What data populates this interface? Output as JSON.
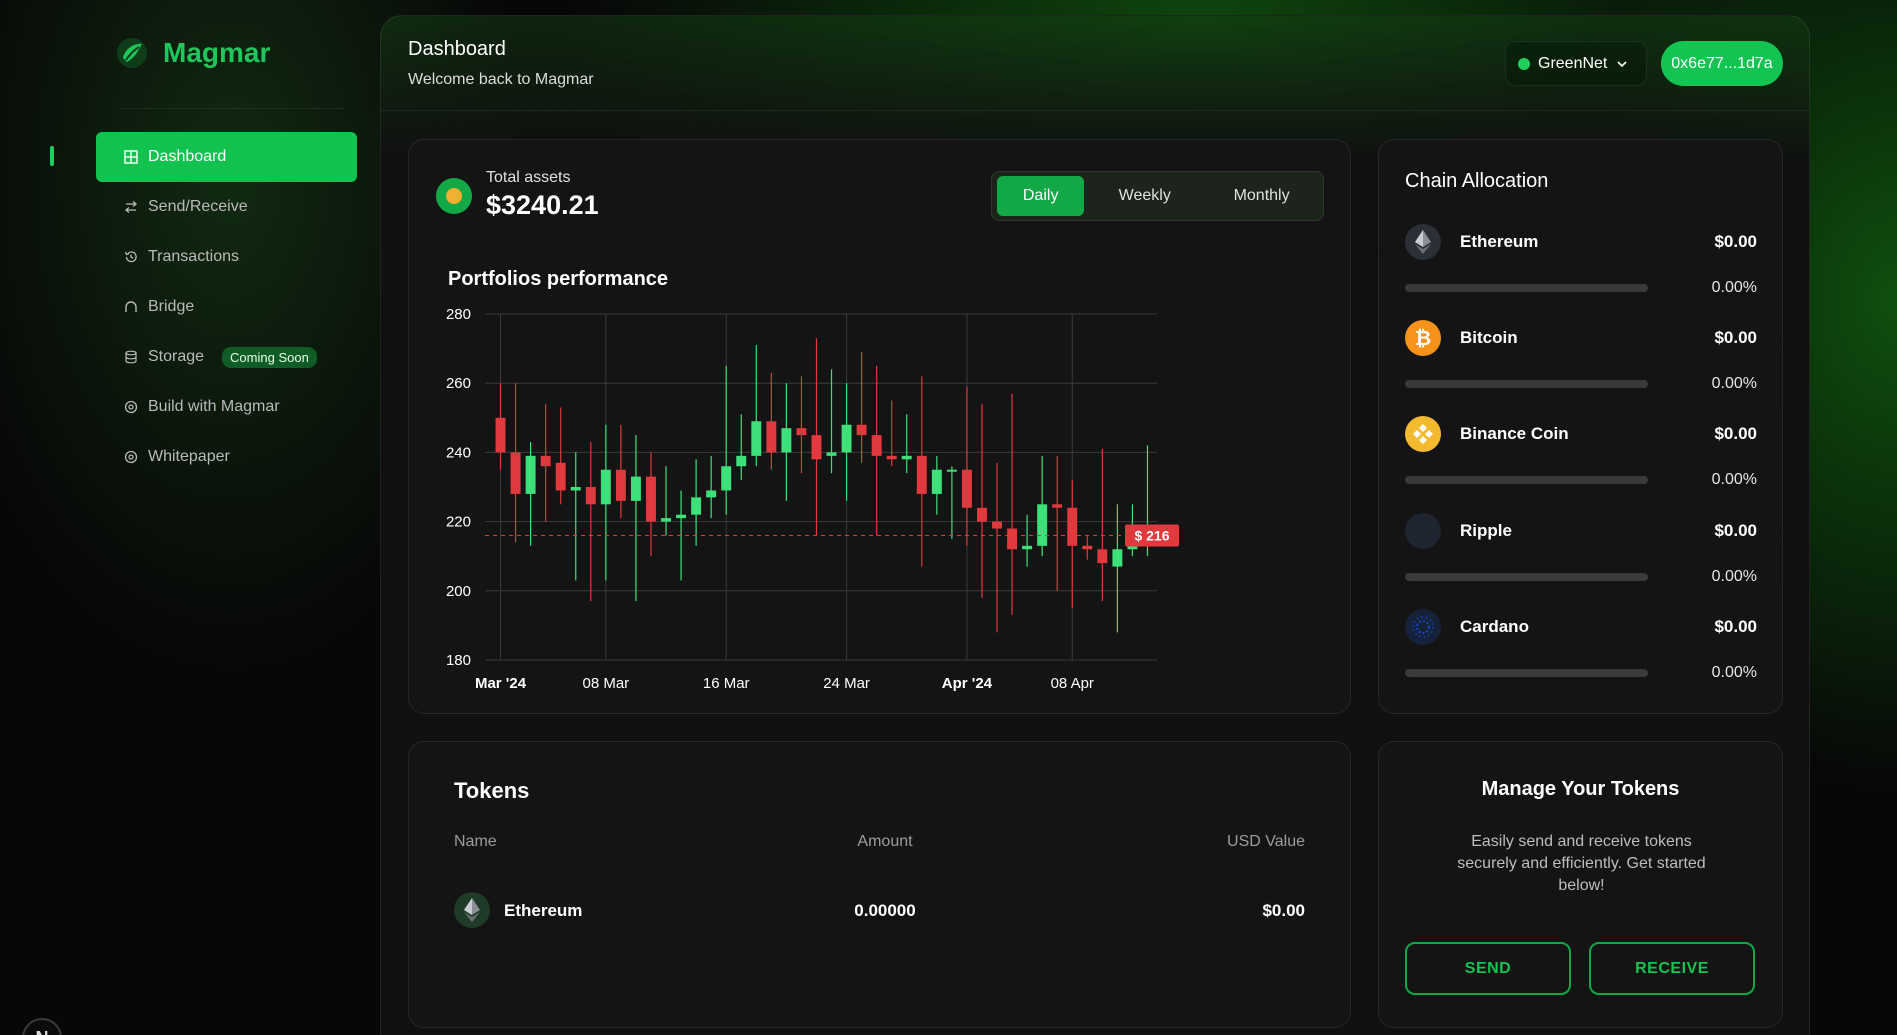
{
  "app": {
    "name": "Magmar",
    "corner_avatar_letter": "N"
  },
  "sidebar": {
    "items": [
      {
        "label": "Dashboard",
        "icon": "grid-icon",
        "active": true
      },
      {
        "label": "Send/Receive",
        "icon": "swap-icon"
      },
      {
        "label": "Transactions",
        "icon": "history-icon"
      },
      {
        "label": "Bridge",
        "icon": "bridge-icon"
      },
      {
        "label": "Storage",
        "icon": "database-icon",
        "badge": "Coming Soon"
      },
      {
        "label": "Build with Magmar",
        "icon": "build-icon"
      },
      {
        "label": "Whitepaper",
        "icon": "document-icon"
      }
    ]
  },
  "header": {
    "title": "Dashboard",
    "subtitle": "Welcome back to Magmar",
    "network": "GreenNet",
    "wallet": "0x6e77...1d7a"
  },
  "portfolio": {
    "total_label": "Total assets",
    "total_value": "$3240.21",
    "ranges": [
      "Daily",
      "Weekly",
      "Monthly"
    ],
    "active_range": "Daily",
    "chart_title": "Portfolios performance"
  },
  "chart_data": {
    "type": "candlestick",
    "title": "Portfolios performance",
    "ylim": [
      180,
      280
    ],
    "yticks": [
      180,
      200,
      220,
      240,
      260,
      280
    ],
    "x_ticks": [
      {
        "label": "Mar '24",
        "index": 0,
        "bold": true
      },
      {
        "label": "08 Mar",
        "index": 7
      },
      {
        "label": "16 Mar",
        "index": 15
      },
      {
        "label": "24 Mar",
        "index": 23
      },
      {
        "label": "Apr '24",
        "index": 31,
        "bold": true
      },
      {
        "label": "08 Apr",
        "index": 38
      }
    ],
    "current_price": 216,
    "current_label": "$ 216",
    "up_color": "#3ee07a",
    "down_color": "#e0393e",
    "candles": [
      {
        "o": 250,
        "c": 240,
        "h": 260,
        "l": 235
      },
      {
        "o": 240,
        "c": 228,
        "h": 260,
        "l": 214
      },
      {
        "o": 228,
        "c": 239,
        "h": 243,
        "l": 213
      },
      {
        "o": 239,
        "c": 236,
        "h": 254,
        "l": 220
      },
      {
        "o": 237,
        "c": 229,
        "h": 253,
        "l": 225
      },
      {
        "o": 229,
        "c": 230,
        "h": 240,
        "l": 203
      },
      {
        "o": 230,
        "c": 225,
        "h": 243,
        "l": 197
      },
      {
        "o": 225,
        "c": 235,
        "h": 248,
        "l": 203
      },
      {
        "o": 235,
        "c": 226,
        "h": 248,
        "l": 221
      },
      {
        "o": 226,
        "c": 233,
        "h": 245,
        "l": 197
      },
      {
        "o": 233,
        "c": 220,
        "h": 240,
        "l": 210
      },
      {
        "o": 220,
        "c": 221,
        "h": 236,
        "l": 216
      },
      {
        "o": 221,
        "c": 222,
        "h": 229,
        "l": 203
      },
      {
        "o": 222,
        "c": 227,
        "h": 238,
        "l": 213
      },
      {
        "o": 227,
        "c": 229,
        "h": 239,
        "l": 221
      },
      {
        "o": 229,
        "c": 236,
        "h": 265,
        "l": 222
      },
      {
        "o": 236,
        "c": 239,
        "h": 251,
        "l": 232
      },
      {
        "o": 239,
        "c": 249,
        "h": 271,
        "l": 236
      },
      {
        "o": 249,
        "c": 240,
        "h": 263,
        "l": 235
      },
      {
        "o": 240,
        "c": 247,
        "h": 260,
        "l": 226
      },
      {
        "o": 247,
        "c": 245,
        "h": 262,
        "l": 234
      },
      {
        "o": 245,
        "c": 238,
        "h": 273,
        "l": 216
      },
      {
        "o": 239,
        "c": 240,
        "h": 264,
        "l": 234
      },
      {
        "o": 240,
        "c": 248,
        "h": 260,
        "l": 226
      },
      {
        "o": 248,
        "c": 245,
        "h": 269,
        "l": 237
      },
      {
        "o": 245,
        "c": 239,
        "h": 265,
        "l": 216
      },
      {
        "o": 239,
        "c": 238,
        "h": 255,
        "l": 236
      },
      {
        "o": 238,
        "c": 239,
        "h": 251,
        "l": 234
      },
      {
        "o": 239,
        "c": 228,
        "h": 262,
        "l": 207
      },
      {
        "o": 228,
        "c": 235,
        "h": 239,
        "l": 222
      },
      {
        "o": 235,
        "c": 235,
        "h": 236,
        "l": 215
      },
      {
        "o": 235,
        "c": 224,
        "h": 259,
        "l": 213
      },
      {
        "o": 224,
        "c": 220,
        "h": 254,
        "l": 198
      },
      {
        "o": 220,
        "c": 218,
        "h": 237,
        "l": 188
      },
      {
        "o": 218,
        "c": 212,
        "h": 257,
        "l": 193
      },
      {
        "o": 212,
        "c": 213,
        "h": 222,
        "l": 207
      },
      {
        "o": 213,
        "c": 225,
        "h": 239,
        "l": 210
      },
      {
        "o": 225,
        "c": 224,
        "h": 239,
        "l": 200
      },
      {
        "o": 224,
        "c": 213,
        "h": 232,
        "l": 195
      },
      {
        "o": 213,
        "c": 212,
        "h": 216,
        "l": 209
      },
      {
        "o": 212,
        "c": 208,
        "h": 241,
        "l": 197
      },
      {
        "o": 207,
        "c": 212,
        "h": 225,
        "l": 188
      },
      {
        "o": 212,
        "c": 214,
        "h": 225,
        "l": 210
      },
      {
        "o": 214,
        "c": 216,
        "h": 242,
        "l": 210
      }
    ]
  },
  "chain_allocation": {
    "title": "Chain Allocation",
    "items": [
      {
        "name": "Ethereum",
        "usd": "$0.00",
        "pct": "0.00%",
        "fill": 0,
        "icon": "ethereum-icon"
      },
      {
        "name": "Bitcoin",
        "usd": "$0.00",
        "pct": "0.00%",
        "fill": 0,
        "icon": "bitcoin-icon"
      },
      {
        "name": "Binance Coin",
        "usd": "$0.00",
        "pct": "0.00%",
        "fill": 0,
        "icon": "binance-icon"
      },
      {
        "name": "Ripple",
        "usd": "$0.00",
        "pct": "0.00%",
        "fill": 0,
        "icon": "ripple-icon"
      },
      {
        "name": "Cardano",
        "usd": "$0.00",
        "pct": "0.00%",
        "fill": 0,
        "icon": "cardano-icon"
      }
    ]
  },
  "tokens": {
    "title": "Tokens",
    "columns": [
      "Name",
      "Amount",
      "USD Value"
    ],
    "rows": [
      {
        "name": "Ethereum",
        "amount": "0.00000",
        "usd": "$0.00",
        "icon": "ethereum-icon"
      }
    ]
  },
  "manage": {
    "title": "Manage Your Tokens",
    "description": "Easily send and receive tokens securely and efficiently. Get started below!",
    "send_label": "SEND",
    "receive_label": "RECEIVE"
  },
  "colors": {
    "accent": "#14c453",
    "brand": "#1fc75a",
    "panel": "#141414"
  }
}
